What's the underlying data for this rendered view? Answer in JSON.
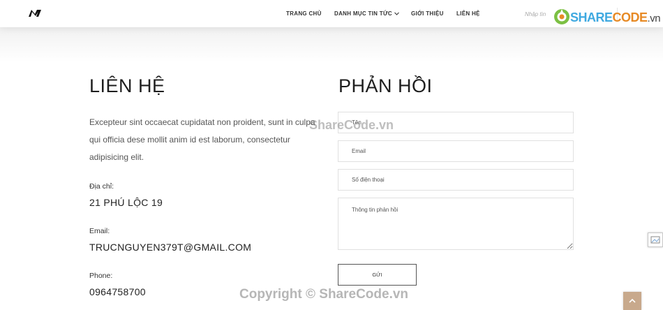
{
  "nav": {
    "items": [
      "TRANG CHỦ",
      "DANH MỤC TIN TỨC",
      "GIỚI THIỆU",
      "LIÊN HỆ"
    ],
    "search_placeholder": "Nhập tìn",
    "brand_logo": {
      "share": "SHARE",
      "code": "CODE",
      "vn": ".vn"
    }
  },
  "contact": {
    "title": "LIÊN HỆ",
    "intro": "Excepteur sint occaecat cupidatat non proident, sunt in culpa qui officia dese mollit anim id est laborum, consectetur adipisicing elit.",
    "address_label": "Địa chỉ:",
    "address_value": "21 PHÚ LỘC 19",
    "email_label": "Email:",
    "email_value": "TRUCNGUYEN379T@GMAIL.COM",
    "phone_label": "Phone:",
    "phone_value": "0964758700"
  },
  "feedback": {
    "title": "PHẢN HỒI",
    "name_placeholder": "Tên",
    "email_placeholder": "Email",
    "phone_placeholder": "Số điện thoại",
    "message_placeholder": "Thông tin phản hồi",
    "send_label": "GỬI"
  },
  "watermarks": {
    "center": "ShareCode.vn",
    "bottom": "Copyright © ShareCode.vn"
  },
  "colors": {
    "brand_blue": "#3fa9e0",
    "brand_orange": "#e78a25",
    "scroll_button": "#c8a98c"
  }
}
